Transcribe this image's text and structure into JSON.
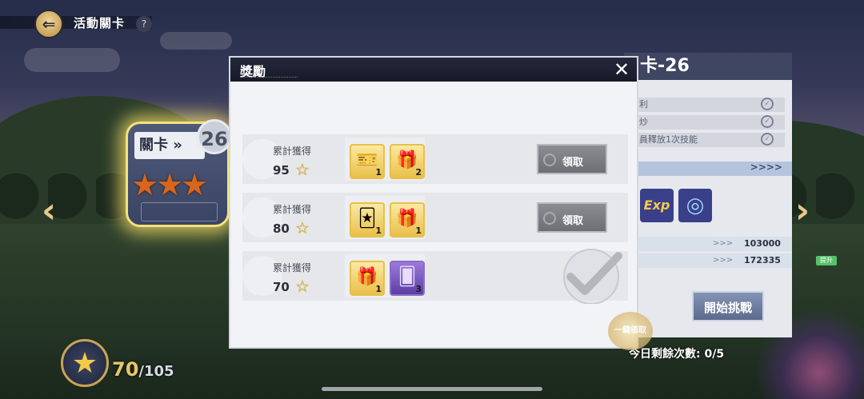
{
  "header": {
    "back_icon": "back-arrow-icon",
    "title": "活動關卡",
    "help_label": "?"
  },
  "stage_card": {
    "label": "關卡 »",
    "number": "26",
    "stars": "★★★"
  },
  "nav": {
    "left": "‹",
    "right": "›"
  },
  "right_panel": {
    "stage_name": "卡-26",
    "conditions": [
      "利",
      "炒",
      "員釋放1次技能"
    ],
    "more_arrows": ">>>>",
    "stats": [
      {
        "arrows": ">>>",
        "value": "103000"
      },
      {
        "arrows": ">>>",
        "value": "172335",
        "tag": "提升"
      }
    ],
    "items": [
      "Exp",
      "◎"
    ],
    "start_button": "開始挑戰",
    "remaining_label": "今日剩餘次數",
    "remaining_value": "0/5"
  },
  "star_total": {
    "current": "70",
    "total": "/105"
  },
  "modal": {
    "title": "獎勵",
    "close": "✕",
    "rows": [
      {
        "label": "累計獲得",
        "stars": "95",
        "items": [
          {
            "icon": "ticket-pack-icon",
            "glyph": "🎫",
            "count": "1",
            "style": "gold"
          },
          {
            "icon": "gift-box-icon",
            "glyph": "🎁",
            "count": "2",
            "style": "gold"
          }
        ],
        "claim": "領取",
        "status": "available"
      },
      {
        "label": "累計獲得",
        "stars": "80",
        "items": [
          {
            "icon": "card-pack-icon",
            "glyph": "🃏",
            "count": "1",
            "style": "gold"
          },
          {
            "icon": "gift-box-icon",
            "glyph": "🎁",
            "count": "1",
            "style": "gold"
          }
        ],
        "claim": "領取",
        "status": "available"
      },
      {
        "label": "累計獲得",
        "stars": "70",
        "items": [
          {
            "icon": "gift-box-icon",
            "glyph": "🎁",
            "count": "1",
            "style": "gold"
          },
          {
            "icon": "purple-card-icon",
            "glyph": "🂠",
            "count": "3",
            "style": "purple"
          }
        ],
        "claim": "",
        "status": "claimed"
      }
    ],
    "claim_all": "一鍵領取"
  },
  "colors": {
    "accent_gold": "#e7c04a",
    "modal_head": "#1c1f2e",
    "claim_gray": "#7c7e83"
  }
}
